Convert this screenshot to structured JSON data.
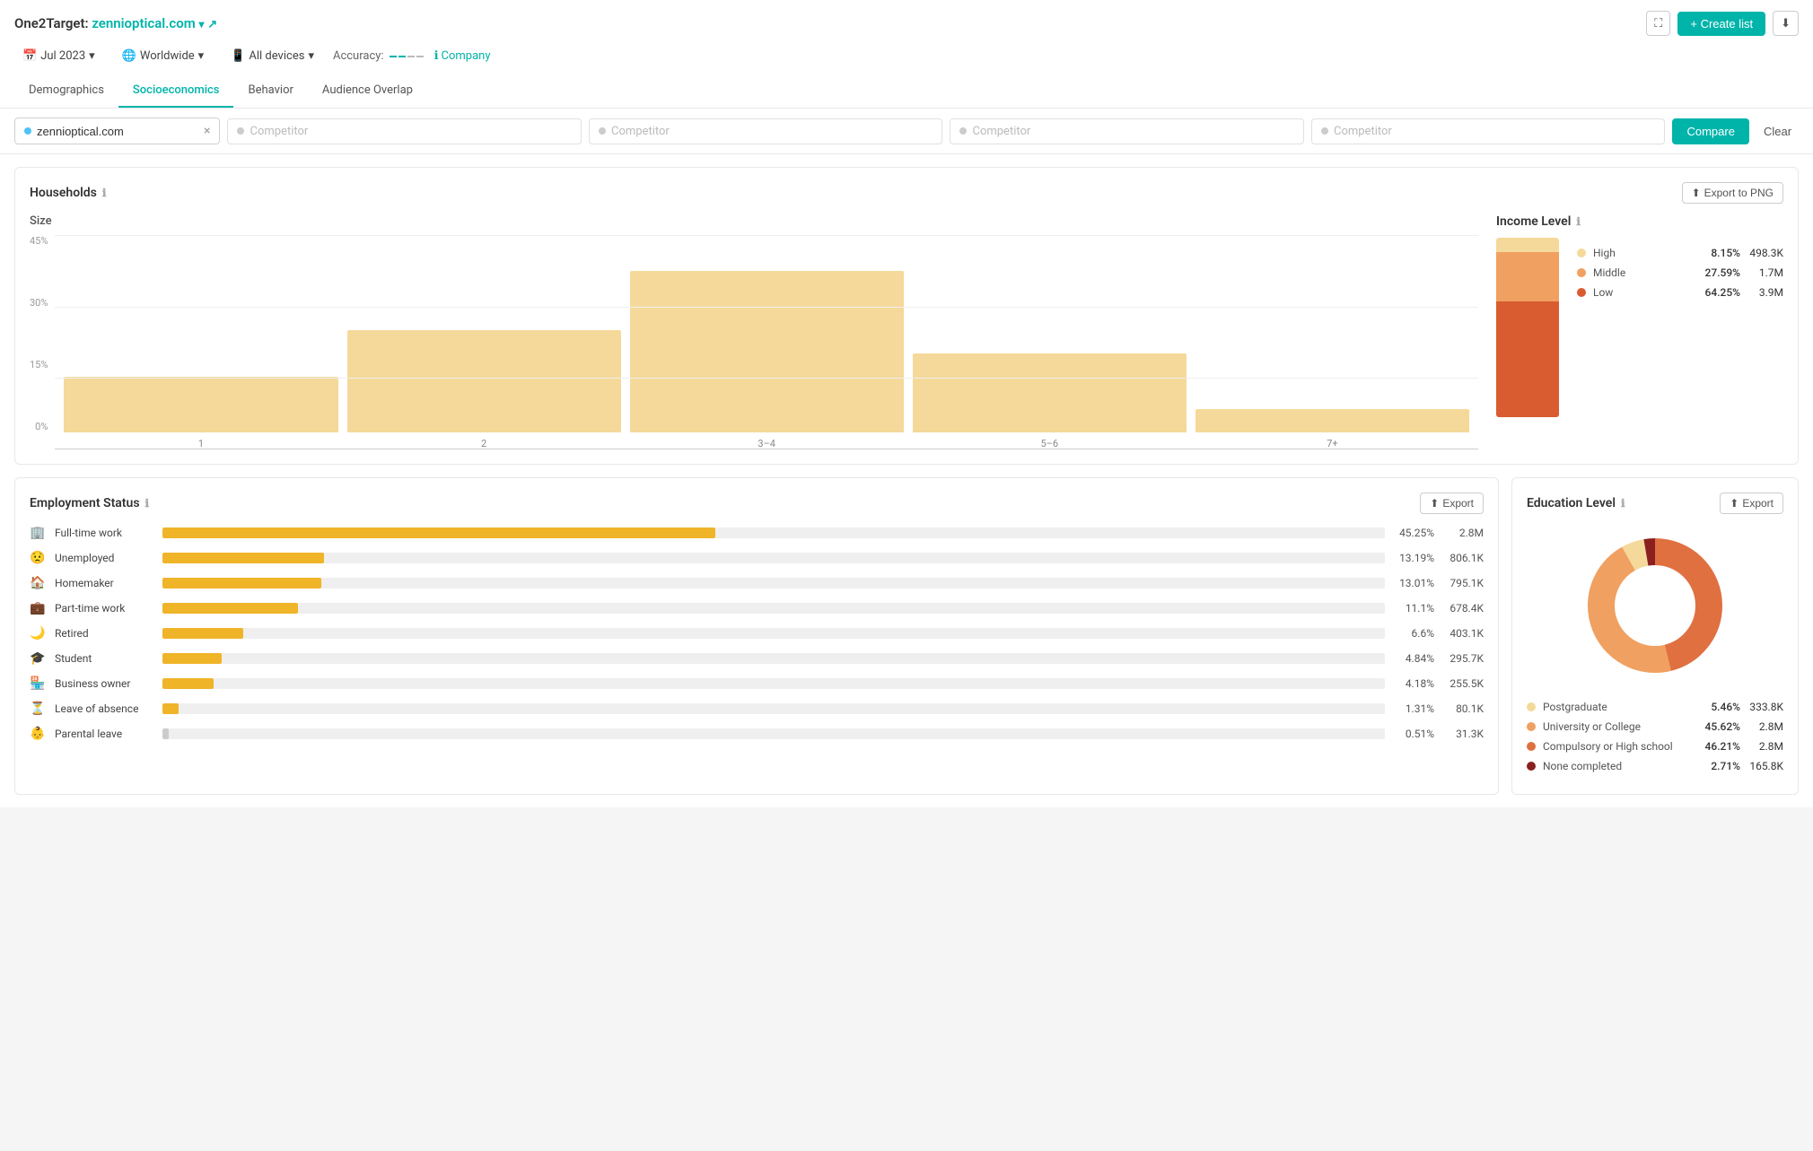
{
  "app": {
    "title": "One2Target:",
    "brand": "zennioptical.com",
    "expand_icon": "⛶",
    "create_list_label": "+ Create list",
    "download_icon": "⬇"
  },
  "filters": {
    "date": "Jul 2023",
    "region": "Worldwide",
    "devices": "All devices",
    "accuracy_label": "Accuracy:",
    "company_label": "Company"
  },
  "tabs": [
    {
      "id": "demographics",
      "label": "Demographics"
    },
    {
      "id": "socioeconomics",
      "label": "Socioeconomics",
      "active": true
    },
    {
      "id": "behavior",
      "label": "Behavior"
    },
    {
      "id": "audience_overlap",
      "label": "Audience Overlap"
    }
  ],
  "search_bar": {
    "main_site": "zennioptical.com",
    "competitor_placeholder": "Competitor",
    "compare_label": "Compare",
    "clear_label": "Clear"
  },
  "households": {
    "title": "Households",
    "export_label": "Export to PNG",
    "size": {
      "title": "Size",
      "y_labels": [
        "45%",
        "30%",
        "15%",
        "0%"
      ],
      "bars": [
        {
          "label": "1",
          "height_pct": 28
        },
        {
          "label": "2",
          "height_pct": 50
        },
        {
          "label": "3–4",
          "height_pct": 78
        },
        {
          "label": "5–6",
          "height_pct": 38
        },
        {
          "label": "7+",
          "height_pct": 12
        }
      ]
    },
    "income": {
      "title": "Income Level",
      "segments": [
        {
          "label": "High",
          "pct": "8.15%",
          "value": "498.3K",
          "color": "#f5d99a",
          "height_pct": 8.15
        },
        {
          "label": "Middle",
          "pct": "27.59%",
          "value": "1.7M",
          "color": "#f0a060",
          "height_pct": 27.59
        },
        {
          "label": "Low",
          "pct": "64.25%",
          "value": "3.9M",
          "color": "#d85c30",
          "height_pct": 64.25
        }
      ]
    }
  },
  "employment": {
    "title": "Employment Status",
    "export_label": "Export",
    "rows": [
      {
        "icon": "🏢",
        "label": "Full-time work",
        "pct": 45.25,
        "pct_label": "45.25%",
        "value": "2.8M"
      },
      {
        "icon": "😟",
        "label": "Unemployed",
        "pct": 13.19,
        "pct_label": "13.19%",
        "value": "806.1K"
      },
      {
        "icon": "🏠",
        "label": "Homemaker",
        "pct": 13.01,
        "pct_label": "13.01%",
        "value": "795.1K"
      },
      {
        "icon": "💼",
        "label": "Part-time work",
        "pct": 11.1,
        "pct_label": "11.1%",
        "value": "678.4K"
      },
      {
        "icon": "🌙",
        "label": "Retired",
        "pct": 6.6,
        "pct_label": "6.6%",
        "value": "403.1K"
      },
      {
        "icon": "🎓",
        "label": "Student",
        "pct": 4.84,
        "pct_label": "4.84%",
        "value": "295.7K"
      },
      {
        "icon": "🏪",
        "label": "Business owner",
        "pct": 4.18,
        "pct_label": "4.18%",
        "value": "255.5K"
      },
      {
        "icon": "⏳",
        "label": "Leave of absence",
        "pct": 1.31,
        "pct_label": "1.31%",
        "value": "80.1K"
      },
      {
        "icon": "👶",
        "label": "Parental leave",
        "pct": 0.51,
        "pct_label": "0.51%",
        "value": "31.3K"
      }
    ]
  },
  "education": {
    "title": "Education Level",
    "export_label": "Export",
    "segments": [
      {
        "label": "Postgraduate",
        "pct": "5.46%",
        "value": "333.8K",
        "color": "#f5d99a",
        "slice_pct": 5.46
      },
      {
        "label": "University or College",
        "pct": "45.62%",
        "value": "2.8M",
        "color": "#f0a060",
        "slice_pct": 45.62
      },
      {
        "label": "Compulsory or High school",
        "pct": "46.21%",
        "value": "2.8M",
        "color": "#e07040",
        "slice_pct": 46.21
      },
      {
        "label": "None completed",
        "pct": "2.71%",
        "value": "165.8K",
        "color": "#8b2020",
        "slice_pct": 2.71
      }
    ]
  }
}
